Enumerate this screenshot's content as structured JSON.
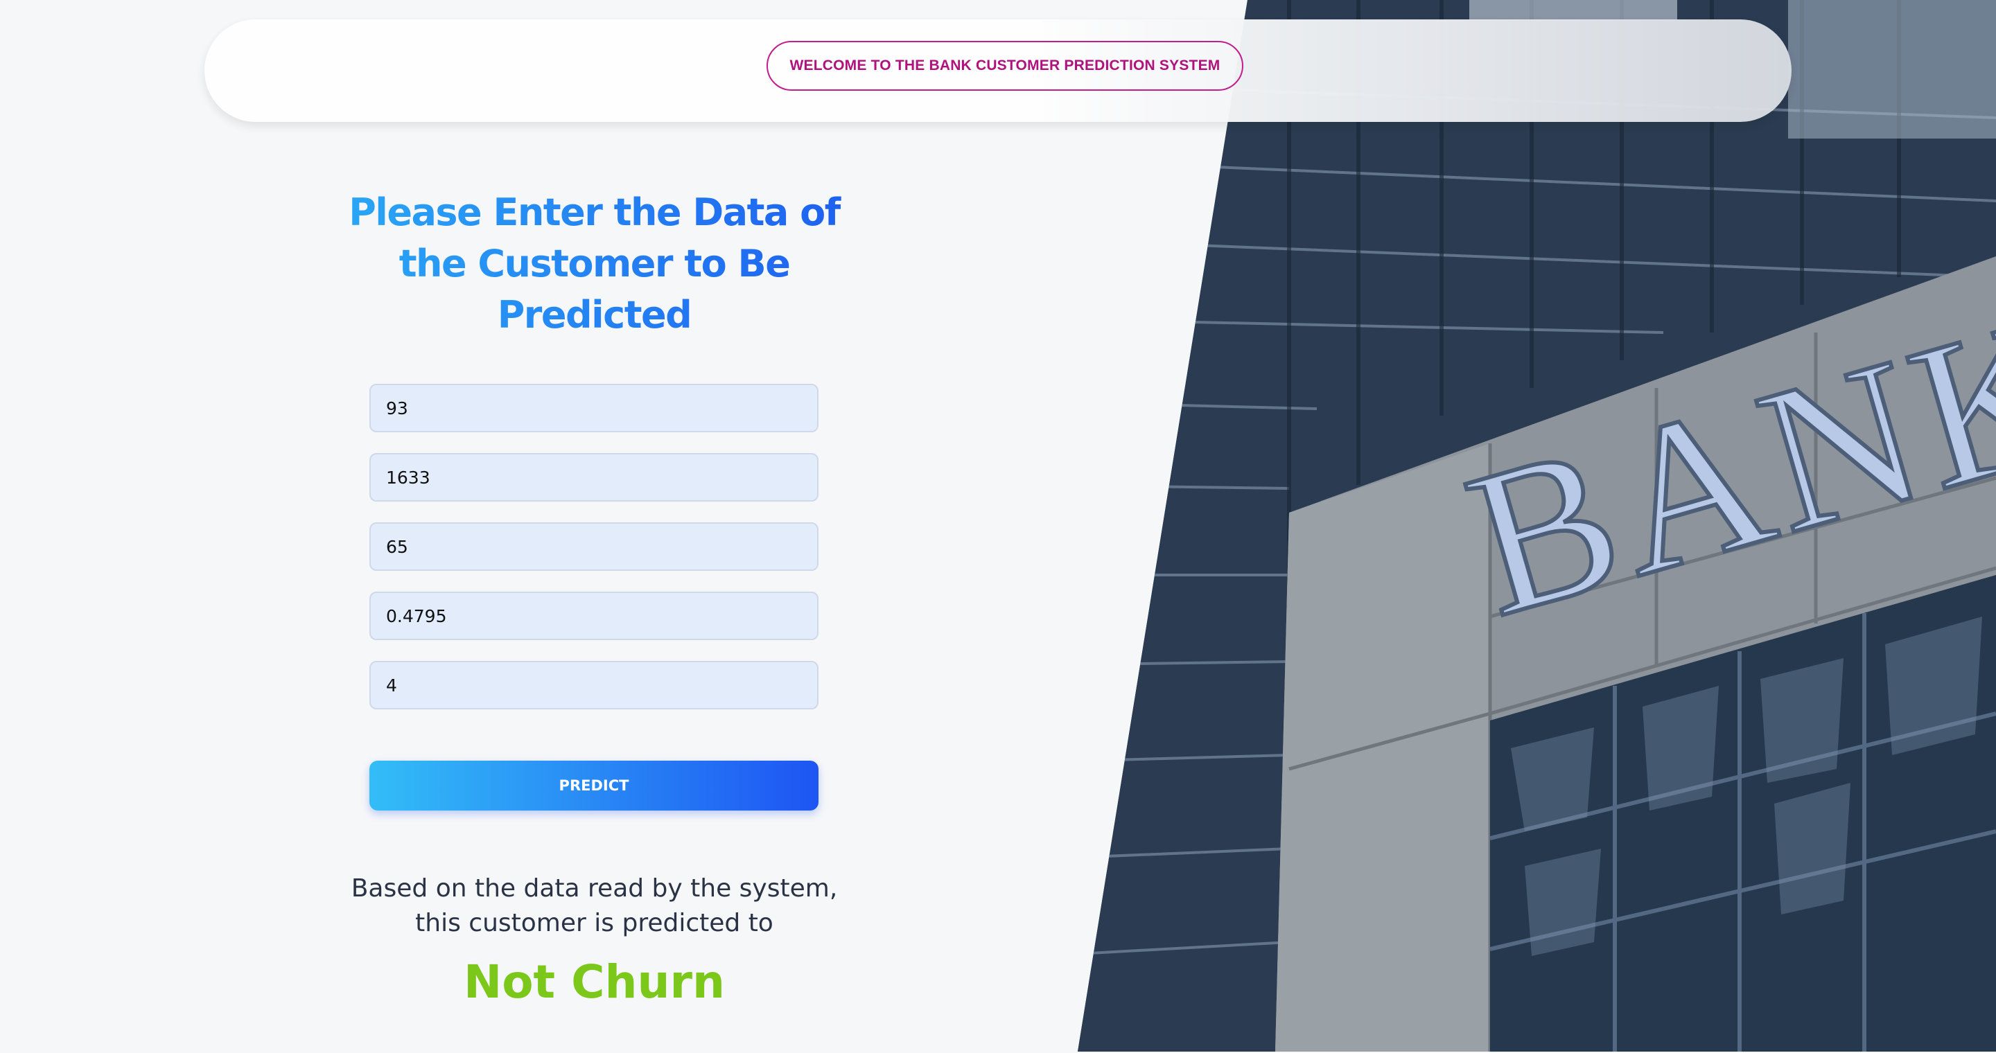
{
  "header": {
    "welcome_label": "WELCOME TO THE BANK CUSTOMER PREDICTION SYSTEM"
  },
  "form": {
    "heading": "Please Enter the Data of the Customer to Be Predicted",
    "fields": [
      {
        "value": "93"
      },
      {
        "value": "1633"
      },
      {
        "value": "65"
      },
      {
        "value": "0.4795"
      },
      {
        "value": "4"
      }
    ],
    "predict_label": "PREDICT"
  },
  "result": {
    "text": "Based on the data read by the system, this customer is predicted to",
    "prediction": "Not Churn"
  },
  "photo": {
    "sign_text": "BANK",
    "description_icon": "bank-building-image"
  },
  "colors": {
    "accent_magenta": "#b0117e",
    "heading_gradient_start": "#2aa8f5",
    "heading_gradient_end": "#1e5ff0",
    "prediction_green": "#7cc81a"
  }
}
